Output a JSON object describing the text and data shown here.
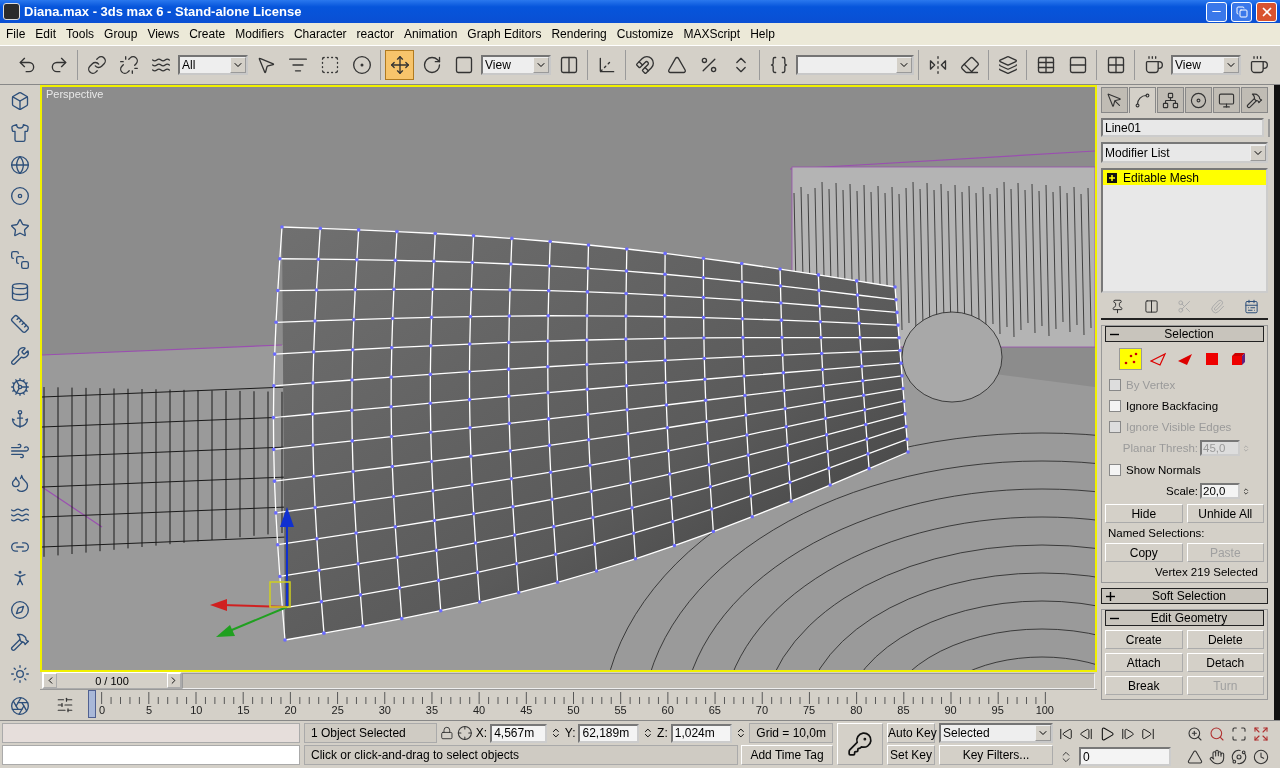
{
  "window": {
    "title": "Diana.max - 3ds max 6 - Stand-alone License"
  },
  "menu": [
    "File",
    "Edit",
    "Tools",
    "Group",
    "Views",
    "Create",
    "Modifiers",
    "Character",
    "reactor",
    "Animation",
    "Graph Editors",
    "Rendering",
    "Customize",
    "MAXScript",
    "Help"
  ],
  "toolbar": {
    "groups": [
      [
        {
          "kind": "button",
          "selected": false
        },
        {
          "kind": "button",
          "selected": false
        }
      ],
      [
        {
          "kind": "button",
          "selected": false
        },
        {
          "kind": "button",
          "selected": false
        },
        {
          "kind": "button",
          "selected": false
        },
        {
          "kind": "dropdown",
          "value": "All"
        },
        {
          "kind": "button",
          "selected": false
        },
        {
          "kind": "button",
          "selected": false
        },
        {
          "kind": "button",
          "selected": false
        },
        {
          "kind": "button",
          "selected": false
        }
      ],
      [
        {
          "kind": "button",
          "selected": true
        },
        {
          "kind": "button",
          "selected": false
        },
        {
          "kind": "button",
          "selected": false
        },
        {
          "kind": "dropdown",
          "value": "View"
        },
        {
          "kind": "button",
          "selected": false
        }
      ],
      [
        {
          "kind": "button",
          "selected": false
        }
      ],
      [
        {
          "kind": "button",
          "selected": false
        },
        {
          "kind": "button",
          "selected": false
        },
        {
          "kind": "button",
          "selected": false
        },
        {
          "kind": "button",
          "selected": false
        }
      ],
      [
        {
          "kind": "button",
          "selected": false
        },
        {
          "kind": "dropdown"
        }
      ],
      [
        {
          "kind": "button",
          "selected": false
        },
        {
          "kind": "button",
          "selected": false
        }
      ],
      [
        {
          "kind": "button",
          "selected": false
        }
      ],
      [
        {
          "kind": "button",
          "selected": false
        },
        {
          "kind": "button",
          "selected": false
        }
      ],
      [
        {
          "kind": "button",
          "selected": false
        }
      ],
      [
        {
          "kind": "button",
          "selected": false
        },
        {
          "kind": "dropdown",
          "value": "View"
        },
        {
          "kind": "button",
          "selected": false
        }
      ]
    ]
  },
  "viewport": {
    "label": "Perspective",
    "active": true
  },
  "time_slider": {
    "label": "0 / 100"
  },
  "track_bar": {
    "labels": [
      "0",
      "5",
      "10",
      "15",
      "20",
      "25",
      "30",
      "35",
      "40",
      "45",
      "50",
      "55",
      "60",
      "65",
      "70",
      "75",
      "80",
      "85",
      "90",
      "95",
      "100"
    ]
  },
  "command_panel": {
    "tabs": [
      {
        "selected": false
      },
      {
        "selected": true
      },
      {
        "selected": false
      },
      {
        "selected": false
      },
      {
        "selected": false
      },
      {
        "selected": false
      }
    ],
    "object_name": "Line01",
    "modifier_list": "Modifier List",
    "stack": [
      {
        "label": "Editable Mesh",
        "selected": true
      }
    ],
    "rollouts": [
      {
        "kind": "selection",
        "title": "Selection",
        "expanded": true,
        "levels": [
          {
            "selected": true
          },
          {
            "selected": false
          },
          {
            "selected": false
          },
          {
            "selected": false
          },
          {
            "selected": false
          }
        ],
        "controls": [
          {
            "kind": "checkbox",
            "label": "By Vertex",
            "checked": false,
            "disabled": true
          },
          {
            "kind": "checkbox",
            "label": "Ignore Backfacing",
            "checked": false,
            "disabled": false
          },
          {
            "kind": "checkbox",
            "label": "Ignore Visible Edges",
            "checked": false,
            "disabled": true
          },
          {
            "kind": "spinner",
            "label": "Planar Thresh:",
            "value": "45,0",
            "disabled": true
          },
          {
            "kind": "checkbox",
            "label": "Show Normals",
            "checked": false,
            "disabled": false
          },
          {
            "kind": "spinner",
            "label": "Scale:",
            "value": "20,0",
            "disabled": false
          }
        ],
        "buttons": [
          {
            "label": "Hide",
            "disabled": false
          },
          {
            "label": "Unhide All",
            "disabled": false
          }
        ],
        "named_label": "Named Selections:",
        "named_buttons": [
          {
            "label": "Copy",
            "disabled": false
          },
          {
            "label": "Paste",
            "disabled": true
          }
        ],
        "status": "Vertex 219 Selected"
      },
      {
        "kind": "plain",
        "title": "Soft Selection",
        "expanded": false
      },
      {
        "kind": "geometry",
        "title": "Edit Geometry",
        "expanded": true,
        "buttons": [
          {
            "label": "Create",
            "disabled": false
          },
          {
            "label": "Delete",
            "disabled": false
          },
          {
            "label": "Attach",
            "disabled": false
          },
          {
            "label": "Detach",
            "disabled": false
          },
          {
            "label": "Break",
            "disabled": false
          },
          {
            "label": "Turn",
            "disabled": true
          }
        ]
      }
    ]
  },
  "status_bar": {
    "selection_info": "1 Object Selected",
    "coords": [
      {
        "axis": "X:",
        "value": "4,567m"
      },
      {
        "axis": "Y:",
        "value": "62,189m"
      },
      {
        "axis": "Z:",
        "value": "1,024m"
      }
    ],
    "grid": "Grid = 10,0m",
    "prompt": "Click or click-and-drag to select objects",
    "time_tag": "Add Time Tag",
    "auto_key": "Auto Key",
    "set_key": "Set Key",
    "key_mode": "Selected",
    "key_filters": "Key Filters...",
    "frame": "0"
  }
}
